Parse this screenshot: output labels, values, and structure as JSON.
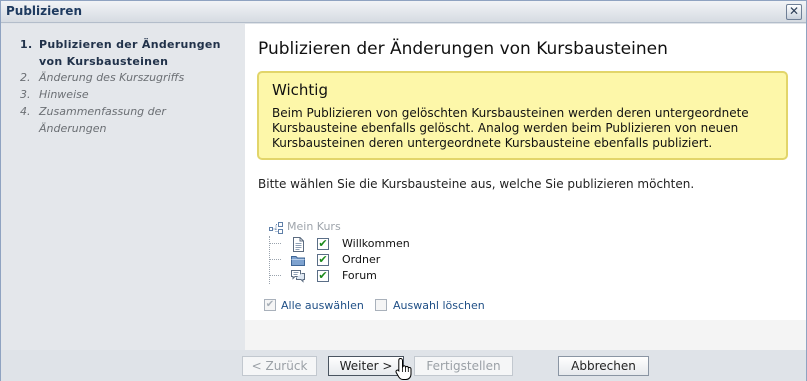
{
  "window": {
    "title": "Publizieren",
    "close_glyph": "✕"
  },
  "steps": [
    {
      "num": "1.",
      "label": "Publizieren der Änderungen von Kursbausteinen",
      "active": true
    },
    {
      "num": "2.",
      "label": "Änderung des Kurszugriffs",
      "active": false
    },
    {
      "num": "3.",
      "label": "Hinweise",
      "active": false
    },
    {
      "num": "4.",
      "label": "Zusammenfassung der Änderungen",
      "active": false
    }
  ],
  "main": {
    "heading": "Publizieren der Änderungen von Kursbausteinen",
    "important": {
      "title": "Wichtig",
      "lines": [
        "Beim Publizieren von gelöschten Kursbausteinen werden deren untergeordnete",
        "Kursbausteine ebenfalls gelöscht. Analog werden beim Publizieren von neuen",
        "Kursbausteinen deren untergeordnete Kursbausteine ebenfalls publiziert."
      ]
    },
    "instruction": "Bitte wählen Sie die Kursbausteine aus, welche Sie publizieren möchten.",
    "tree": {
      "root": {
        "label": "Mein Kurs",
        "icon": "structure-icon"
      },
      "items": [
        {
          "label": "Willkommen",
          "icon": "page-icon",
          "checked": true
        },
        {
          "label": "Ordner",
          "icon": "folder-icon",
          "checked": true
        },
        {
          "label": "Forum",
          "icon": "forum-icon",
          "checked": true
        }
      ]
    },
    "select_all": {
      "label": "Alle auswählen",
      "checked": true
    },
    "deselect_all": {
      "label": "Auswahl löschen",
      "checked": false
    }
  },
  "buttons": {
    "back": "< Zurück",
    "next": "Weiter >",
    "finish": "Fertigstellen",
    "cancel": "Abbrechen"
  },
  "colors": {
    "important_bg": "#fdf7a9",
    "important_border": "#e2d56a",
    "check_green": "#1b8a1b",
    "title_blue": "#1e3a5f"
  }
}
